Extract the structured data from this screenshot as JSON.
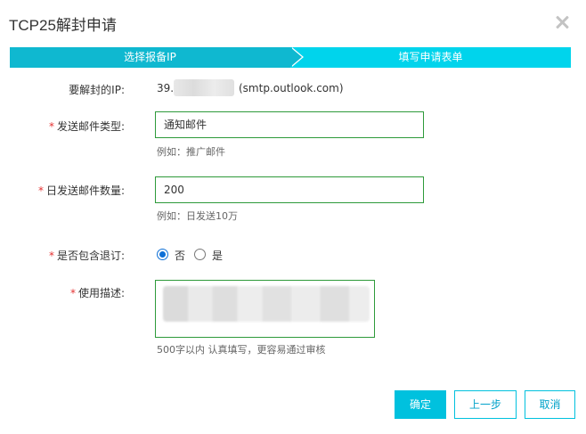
{
  "dialog": {
    "title": "TCP25解封申请",
    "close_icon": "close-icon"
  },
  "steps": [
    {
      "label": "选择报备IP",
      "state": "done",
      "color": "#0fb8d0"
    },
    {
      "label": "填写申请表单",
      "state": "active",
      "color": "#00d4ec"
    }
  ],
  "form": {
    "ip": {
      "label": "要解封的IP:",
      "prefix": "39.",
      "suffix": "(smtp.outlook.com)"
    },
    "mail_type": {
      "required_mark": "*",
      "label": "发送邮件类型:",
      "value": "通知邮件",
      "hint": "例如：推广邮件"
    },
    "daily_count": {
      "required_mark": "*",
      "label": "日发送邮件数量:",
      "value": "200",
      "hint": "例如：日发送10万"
    },
    "unsubscribe": {
      "required_mark": "*",
      "label": "是否包含退订:",
      "options": [
        {
          "label": "否",
          "checked": true
        },
        {
          "label": "是",
          "checked": false
        }
      ]
    },
    "usage": {
      "required_mark": "*",
      "label": "使用描述:",
      "hint": "500字以内 认真填写，更容易通过审核"
    }
  },
  "buttons": {
    "confirm": "确定",
    "back": "上一步",
    "cancel": "取消"
  },
  "colors": {
    "accent": "#00c1de",
    "input_border": "#2e9a3a",
    "required": "#e53333"
  }
}
